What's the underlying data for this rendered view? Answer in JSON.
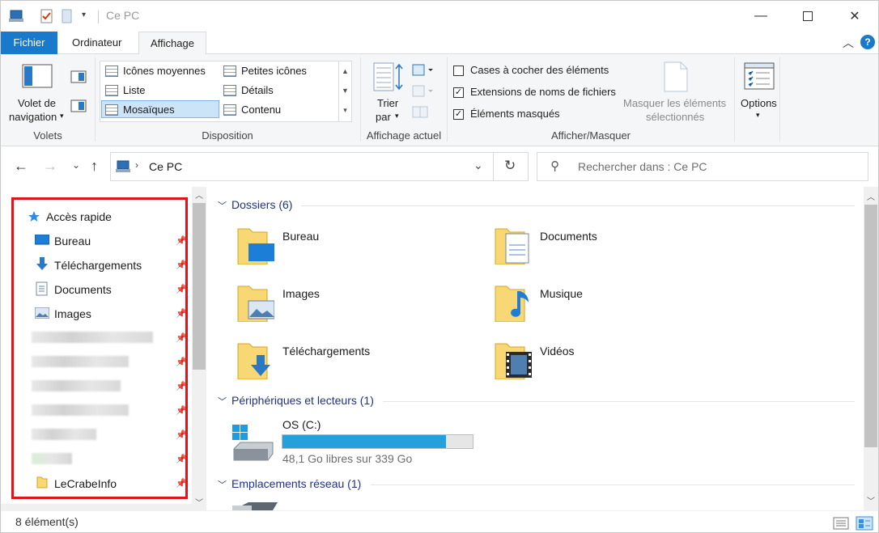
{
  "window": {
    "title": "Ce PC"
  },
  "ribbon": {
    "tabs": [
      "Fichier",
      "Ordinateur",
      "Affichage"
    ],
    "volets": {
      "nav_pane_line1": "Volet de",
      "nav_pane_line2": "navigation",
      "group": "Volets"
    },
    "disposition": {
      "items": [
        "Icônes moyennes",
        "Petites icônes",
        "Liste",
        "Détails",
        "Mosaïques",
        "Contenu"
      ],
      "selected": "Mosaïques",
      "group": "Disposition"
    },
    "affichage_actuel": {
      "sort_line1": "Trier",
      "sort_line2": "par",
      "group": "Affichage actuel"
    },
    "afficher_masquer": {
      "checkboxes": [
        {
          "label": "Cases à cocher des éléments",
          "checked": false
        },
        {
          "label": "Extensions de noms de fichiers",
          "checked": true
        },
        {
          "label": "Éléments masqués",
          "checked": true
        }
      ],
      "hide_selected_line1": "Masquer les éléments",
      "hide_selected_line2": "sélectionnés",
      "group": "Afficher/Masquer"
    },
    "options": "Options"
  },
  "address": {
    "path": "Ce PC",
    "search_placeholder": "Rechercher dans : Ce PC"
  },
  "nav_pane": {
    "quick_access": "Accès rapide",
    "items": [
      "Bureau",
      "Téléchargements",
      "Documents",
      "Images"
    ],
    "last_item": "LeCrabeInfo"
  },
  "content": {
    "folders_header": "Dossiers (6)",
    "folders": [
      "Bureau",
      "Documents",
      "Images",
      "Musique",
      "Téléchargements",
      "Vidéos"
    ],
    "devices_header": "Périphériques et lecteurs (1)",
    "drive": {
      "name": "OS (C:)",
      "free": "48,1 Go libres sur 339 Go",
      "used_fraction": 0.858
    },
    "network_header": "Emplacements réseau (1)"
  },
  "status": {
    "count": "8 élément(s)"
  },
  "colors": {
    "accent": "#1979ca",
    "highlight": "#e0151b",
    "drive_bar": "#26a0da"
  }
}
